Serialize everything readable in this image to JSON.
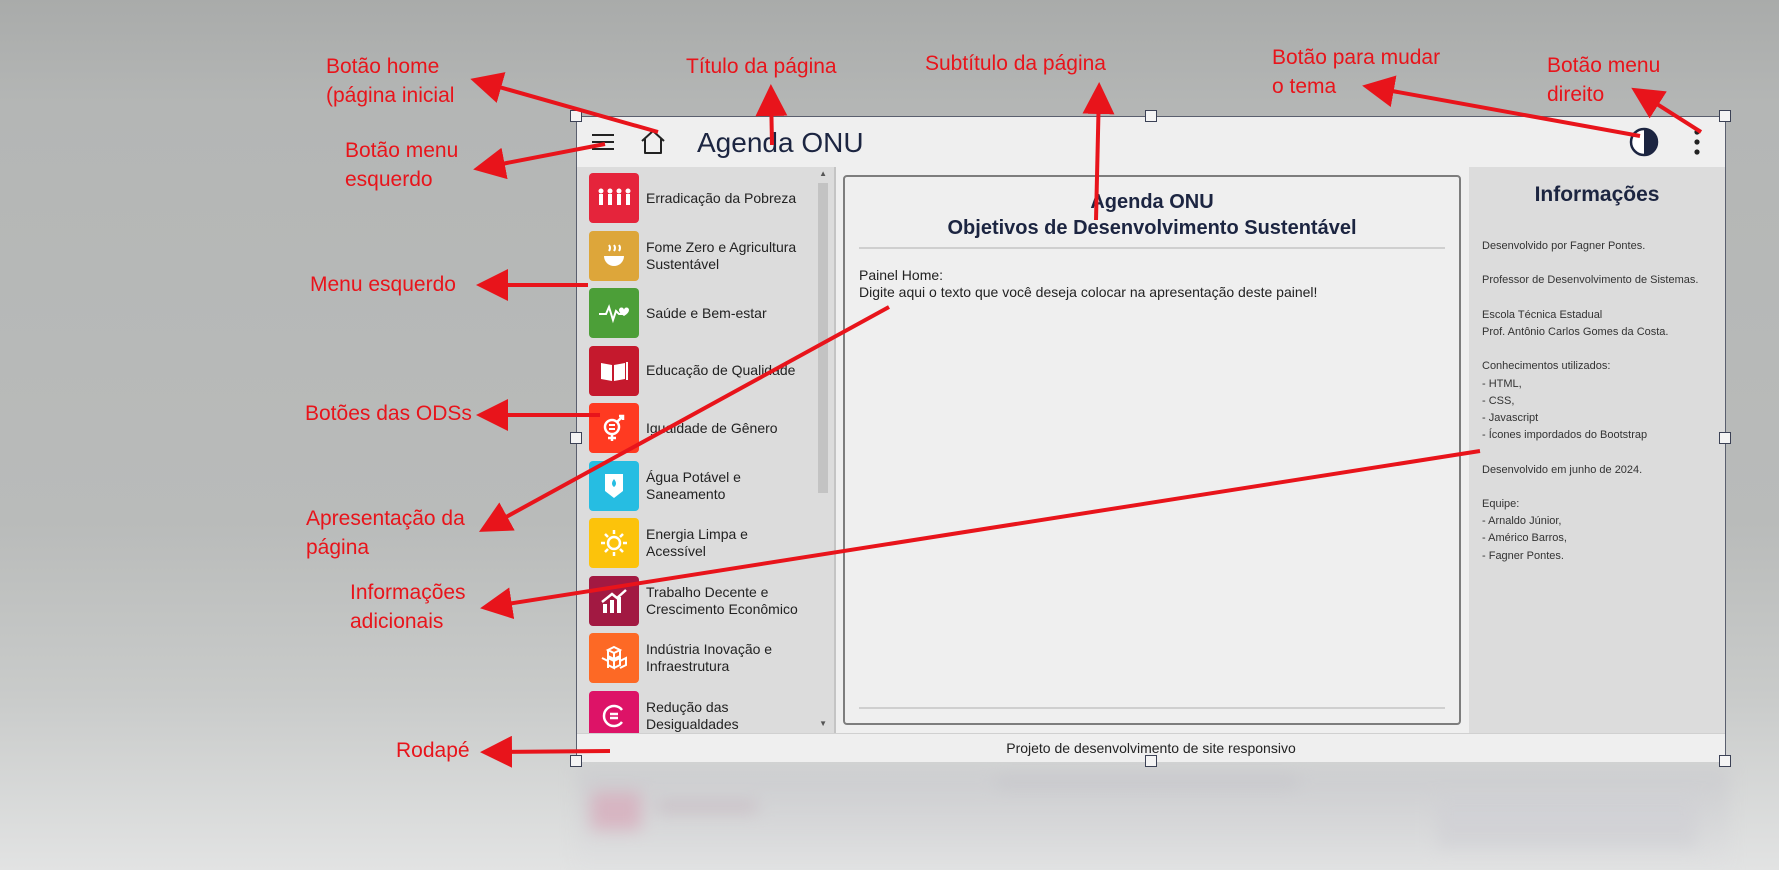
{
  "header": {
    "title": "Agenda ONU"
  },
  "icons": {
    "menu_left": "hamburger-icon",
    "home": "house-icon",
    "theme": "half-circle-contrast-icon",
    "menu_right": "vertical-dots-icon"
  },
  "left_menu": {
    "items": [
      {
        "label": "Erradicação da Pobreza",
        "color": "#e5243b"
      },
      {
        "label": "Fome Zero e Agricultura Sustentável",
        "color": "#dda63a"
      },
      {
        "label": "Saúde e Bem-estar",
        "color": "#4c9f38"
      },
      {
        "label": "Educação de Qualidade",
        "color": "#c5192d"
      },
      {
        "label": "Igualdade de Gênero",
        "color": "#ff3a21"
      },
      {
        "label": "Água Potável e Saneamento",
        "color": "#26bde2"
      },
      {
        "label": "Energia Limpa e Acessível",
        "color": "#fcc30b"
      },
      {
        "label": "Trabalho Decente e Crescimento Econômico",
        "color": "#a21942"
      },
      {
        "label": "Indústria Inovação e Infraestrutura",
        "color": "#fd6925"
      },
      {
        "label": "Redução das Desigualdades",
        "color": "#dd1367"
      }
    ]
  },
  "main": {
    "heading": "Agenda ONU",
    "subheading": "Objetivos de Desenvolvimento Sustentável",
    "panel_label": "Painel Home:",
    "panel_text": "Digite aqui o texto que você deseja colocar na apresentação deste painel!"
  },
  "info": {
    "title": "Informações",
    "lines": [
      "Desenvolvido por Fagner Pontes.",
      "",
      "Professor de Desenvolvimento de Sistemas.",
      "",
      "Escola Técnica Estadual",
      "Prof. Antônio Carlos Gomes da Costa.",
      "",
      "Conhecimentos utilizados:",
      "- HTML,",
      "- CSS,",
      "- Javascript",
      "- Ícones impordados do Bootstrap",
      "",
      "Desenvolvido em junho de 2024.",
      "",
      "Equipe:",
      "- Arnaldo Júnior,",
      "- Américo Barros,",
      "- Fagner Pontes."
    ]
  },
  "footer": {
    "text": "Projeto de desenvolvimento de site responsivo"
  },
  "annotations": {
    "home_button": "Botão home",
    "home_button_2": "(página inicial",
    "page_title": "Título da página",
    "page_subtitle": "Subtítulo da página",
    "theme_button": "Botão para mudar",
    "theme_button_2": "o tema",
    "right_menu_button": "Botão menu",
    "right_menu_button_2": "direito",
    "left_menu_button": "Botão menu",
    "left_menu_button_2": "esquerdo",
    "left_menu": "Menu esquerdo",
    "ods_buttons": "Botões das ODSs",
    "page_presentation": "Apresentação da",
    "page_presentation_2": "página",
    "additional_info": "Informações",
    "additional_info_2": "adicionais",
    "footer": "Rodapé"
  },
  "colors": {
    "annotation": "#e8141b",
    "title_text": "#1c2541",
    "frame": "#5a5f6e"
  }
}
